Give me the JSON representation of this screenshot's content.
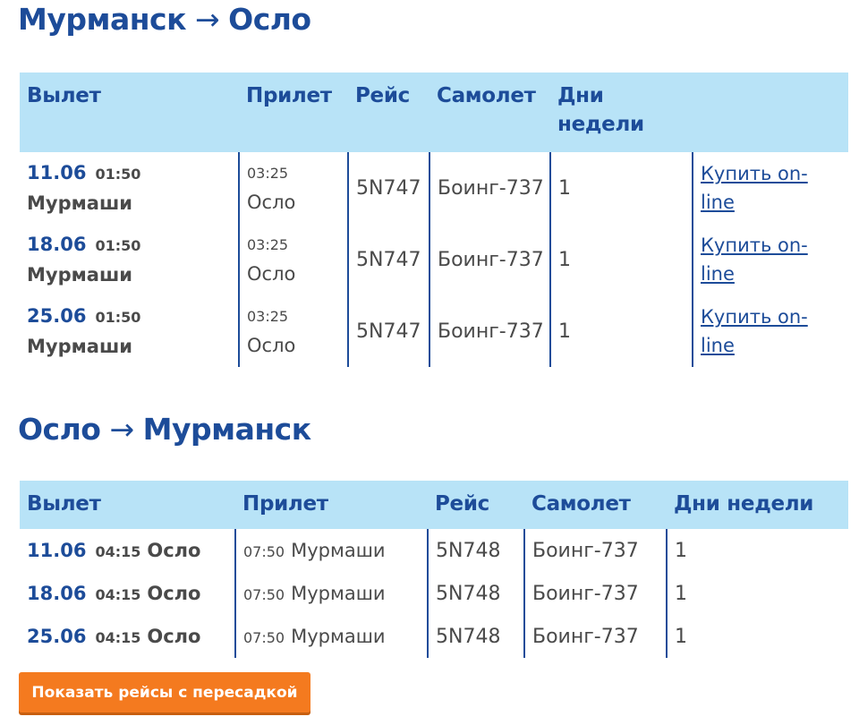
{
  "colors": {
    "heading": "#1d4c99",
    "header_bg": "#b8e3f7",
    "button_bg": "#f47a1f",
    "text": "#4a4a4a"
  },
  "route_out": {
    "from": "Мурманск",
    "arrow": "→",
    "to": "Осло",
    "headers": {
      "departure": "Вылет",
      "arrival": "Прилет",
      "flight": "Рейс",
      "aircraft": "Самолет",
      "days": "Дни недели",
      "action": ""
    },
    "rows": [
      {
        "date": "11.06",
        "dep_time": "01:50",
        "dep_airport": "Мурмаши",
        "arr_time": "03:25",
        "arr_airport": "Осло",
        "flight": "5N747",
        "aircraft": "Боинг-737",
        "days": "1",
        "buy": "Купить on-line"
      },
      {
        "date": "18.06",
        "dep_time": "01:50",
        "dep_airport": "Мурмаши",
        "arr_time": "03:25",
        "arr_airport": "Осло",
        "flight": "5N747",
        "aircraft": "Боинг-737",
        "days": "1",
        "buy": "Купить on-line"
      },
      {
        "date": "25.06",
        "dep_time": "01:50",
        "dep_airport": "Мурмаши",
        "arr_time": "03:25",
        "arr_airport": "Осло",
        "flight": "5N747",
        "aircraft": "Боинг-737",
        "days": "1",
        "buy": "Купить on-line"
      }
    ]
  },
  "route_back": {
    "from": "Осло",
    "arrow": "→",
    "to": "Мурманск",
    "headers": {
      "departure": "Вылет",
      "arrival": "Прилет",
      "flight": "Рейс",
      "aircraft": "Самолет",
      "days": "Дни недели"
    },
    "rows": [
      {
        "date": "11.06",
        "dep_time": "04:15",
        "dep_airport": "Осло",
        "arr_time": "07:50",
        "arr_airport": "Мурмаши",
        "flight": "5N748",
        "aircraft": "Боинг-737",
        "days": "1"
      },
      {
        "date": "18.06",
        "dep_time": "04:15",
        "dep_airport": "Осло",
        "arr_time": "07:50",
        "arr_airport": "Мурмаши",
        "flight": "5N748",
        "aircraft": "Боинг-737",
        "days": "1"
      },
      {
        "date": "25.06",
        "dep_time": "04:15",
        "dep_airport": "Осло",
        "arr_time": "07:50",
        "arr_airport": "Мурмаши",
        "flight": "5N748",
        "aircraft": "Боинг-737",
        "days": "1"
      }
    ]
  },
  "transfer_button": "Показать рейсы с пересадкой"
}
